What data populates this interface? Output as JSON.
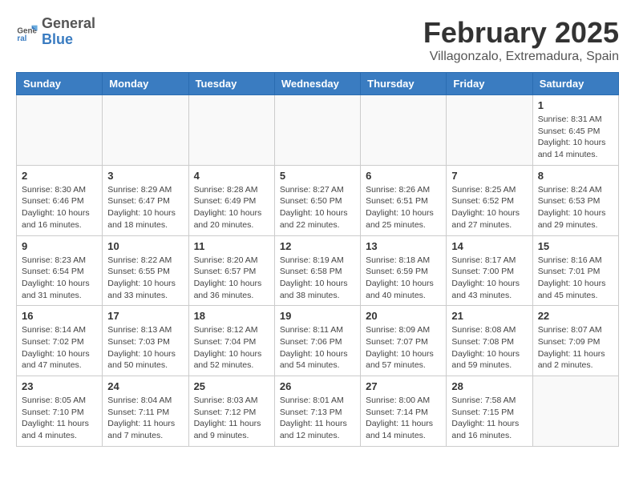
{
  "logo": {
    "general": "General",
    "blue": "Blue"
  },
  "header": {
    "month": "February 2025",
    "location": "Villagonzalo, Extremadura, Spain"
  },
  "weekdays": [
    "Sunday",
    "Monday",
    "Tuesday",
    "Wednesday",
    "Thursday",
    "Friday",
    "Saturday"
  ],
  "weeks": [
    [
      {
        "day": "",
        "info": ""
      },
      {
        "day": "",
        "info": ""
      },
      {
        "day": "",
        "info": ""
      },
      {
        "day": "",
        "info": ""
      },
      {
        "day": "",
        "info": ""
      },
      {
        "day": "",
        "info": ""
      },
      {
        "day": "1",
        "info": "Sunrise: 8:31 AM\nSunset: 6:45 PM\nDaylight: 10 hours and 14 minutes."
      }
    ],
    [
      {
        "day": "2",
        "info": "Sunrise: 8:30 AM\nSunset: 6:46 PM\nDaylight: 10 hours and 16 minutes."
      },
      {
        "day": "3",
        "info": "Sunrise: 8:29 AM\nSunset: 6:47 PM\nDaylight: 10 hours and 18 minutes."
      },
      {
        "day": "4",
        "info": "Sunrise: 8:28 AM\nSunset: 6:49 PM\nDaylight: 10 hours and 20 minutes."
      },
      {
        "day": "5",
        "info": "Sunrise: 8:27 AM\nSunset: 6:50 PM\nDaylight: 10 hours and 22 minutes."
      },
      {
        "day": "6",
        "info": "Sunrise: 8:26 AM\nSunset: 6:51 PM\nDaylight: 10 hours and 25 minutes."
      },
      {
        "day": "7",
        "info": "Sunrise: 8:25 AM\nSunset: 6:52 PM\nDaylight: 10 hours and 27 minutes."
      },
      {
        "day": "8",
        "info": "Sunrise: 8:24 AM\nSunset: 6:53 PM\nDaylight: 10 hours and 29 minutes."
      }
    ],
    [
      {
        "day": "9",
        "info": "Sunrise: 8:23 AM\nSunset: 6:54 PM\nDaylight: 10 hours and 31 minutes."
      },
      {
        "day": "10",
        "info": "Sunrise: 8:22 AM\nSunset: 6:55 PM\nDaylight: 10 hours and 33 minutes."
      },
      {
        "day": "11",
        "info": "Sunrise: 8:20 AM\nSunset: 6:57 PM\nDaylight: 10 hours and 36 minutes."
      },
      {
        "day": "12",
        "info": "Sunrise: 8:19 AM\nSunset: 6:58 PM\nDaylight: 10 hours and 38 minutes."
      },
      {
        "day": "13",
        "info": "Sunrise: 8:18 AM\nSunset: 6:59 PM\nDaylight: 10 hours and 40 minutes."
      },
      {
        "day": "14",
        "info": "Sunrise: 8:17 AM\nSunset: 7:00 PM\nDaylight: 10 hours and 43 minutes."
      },
      {
        "day": "15",
        "info": "Sunrise: 8:16 AM\nSunset: 7:01 PM\nDaylight: 10 hours and 45 minutes."
      }
    ],
    [
      {
        "day": "16",
        "info": "Sunrise: 8:14 AM\nSunset: 7:02 PM\nDaylight: 10 hours and 47 minutes."
      },
      {
        "day": "17",
        "info": "Sunrise: 8:13 AM\nSunset: 7:03 PM\nDaylight: 10 hours and 50 minutes."
      },
      {
        "day": "18",
        "info": "Sunrise: 8:12 AM\nSunset: 7:04 PM\nDaylight: 10 hours and 52 minutes."
      },
      {
        "day": "19",
        "info": "Sunrise: 8:11 AM\nSunset: 7:06 PM\nDaylight: 10 hours and 54 minutes."
      },
      {
        "day": "20",
        "info": "Sunrise: 8:09 AM\nSunset: 7:07 PM\nDaylight: 10 hours and 57 minutes."
      },
      {
        "day": "21",
        "info": "Sunrise: 8:08 AM\nSunset: 7:08 PM\nDaylight: 10 hours and 59 minutes."
      },
      {
        "day": "22",
        "info": "Sunrise: 8:07 AM\nSunset: 7:09 PM\nDaylight: 11 hours and 2 minutes."
      }
    ],
    [
      {
        "day": "23",
        "info": "Sunrise: 8:05 AM\nSunset: 7:10 PM\nDaylight: 11 hours and 4 minutes."
      },
      {
        "day": "24",
        "info": "Sunrise: 8:04 AM\nSunset: 7:11 PM\nDaylight: 11 hours and 7 minutes."
      },
      {
        "day": "25",
        "info": "Sunrise: 8:03 AM\nSunset: 7:12 PM\nDaylight: 11 hours and 9 minutes."
      },
      {
        "day": "26",
        "info": "Sunrise: 8:01 AM\nSunset: 7:13 PM\nDaylight: 11 hours and 12 minutes."
      },
      {
        "day": "27",
        "info": "Sunrise: 8:00 AM\nSunset: 7:14 PM\nDaylight: 11 hours and 14 minutes."
      },
      {
        "day": "28",
        "info": "Sunrise: 7:58 AM\nSunset: 7:15 PM\nDaylight: 11 hours and 16 minutes."
      },
      {
        "day": "",
        "info": ""
      }
    ]
  ]
}
